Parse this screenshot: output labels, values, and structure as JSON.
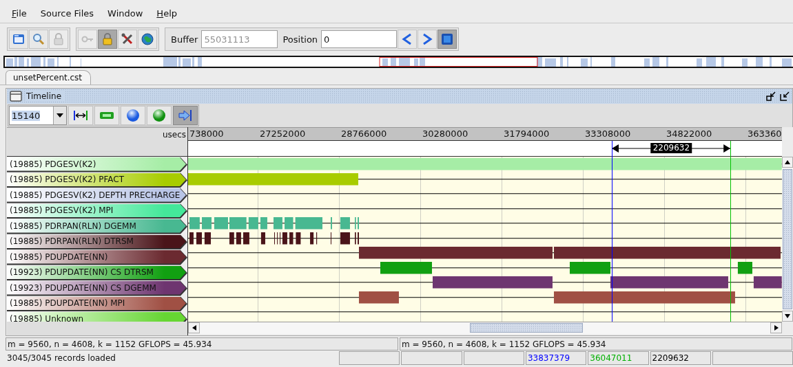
{
  "menu": [
    {
      "label": "File",
      "mnemonic": true
    },
    {
      "label": "Source Files",
      "mnemonic": false
    },
    {
      "label": "Window",
      "mnemonic": false
    },
    {
      "label": "Help",
      "mnemonic": true
    }
  ],
  "toolbar": {
    "groups": [
      [
        {
          "kind": "folder",
          "disabled": false,
          "pressed": false
        },
        {
          "kind": "magnifier",
          "disabled": false,
          "pressed": false
        },
        {
          "kind": "padlock",
          "disabled": true,
          "pressed": false
        }
      ],
      [
        {
          "kind": "key",
          "disabled": true,
          "pressed": false
        },
        {
          "kind": "padlock",
          "disabled": false,
          "pressed": true
        },
        {
          "kind": "tools",
          "disabled": false,
          "pressed": false
        },
        {
          "kind": "globe",
          "disabled": false,
          "pressed": false
        }
      ]
    ],
    "buffer": {
      "label": "Buffer",
      "value": "55031113",
      "disabled": true
    },
    "position": {
      "label": "Position",
      "value": "0"
    },
    "nav": [
      {
        "kind": "prev",
        "disabled": false,
        "pressed": false
      },
      {
        "kind": "next",
        "disabled": false,
        "pressed": false
      },
      {
        "kind": "fit",
        "disabled": false,
        "pressed": true
      }
    ]
  },
  "tabs": [
    {
      "label": "unsetPercent.cst",
      "selected": true
    }
  ],
  "panel": {
    "title": "Timeline"
  },
  "timeline_toolbar": {
    "zoom": "15140",
    "tools": [
      {
        "kind": "span",
        "pressed": false
      },
      {
        "kind": "bar",
        "pressed": false
      },
      {
        "kind": "blue-ball",
        "pressed": false
      },
      {
        "kind": "green-ball",
        "pressed": false
      },
      {
        "kind": "jump",
        "pressed": true
      }
    ]
  },
  "axis": {
    "unit": "usecs",
    "ticks": [
      "738000",
      "27252000",
      "28766000",
      "30280000",
      "31794000",
      "33308000",
      "34822000",
      "363360"
    ],
    "measurement": "2209632"
  },
  "cursors": [
    {
      "color": "#0000ff"
    },
    {
      "color": "#00c000"
    }
  ],
  "rows": [
    {
      "label": "(19885) PDGESV(K2)",
      "color": "#a6eda6"
    },
    {
      "label": "(19885) PDGESV(K2) PFACT",
      "color": "#a8cc00"
    },
    {
      "label": "(19885) PDGESV(K2) DEPTH PRECHARGE",
      "color": "#b8c4e6"
    },
    {
      "label": "(19885) PDGESV(K2) MPI",
      "color": "#44e89a"
    },
    {
      "label": "(19885) PDRPAN(RLN) DGEMM",
      "color": "#48b891"
    },
    {
      "label": "(19885) PDRPAN(RLN) DTRSM",
      "color": "#4a1419"
    },
    {
      "label": "(19885) PDUPDATE(NN)",
      "color": "#6b2a30"
    },
    {
      "label": "(19923) PDUPDATE(NN) CS DTRSM",
      "color": "#11a011"
    },
    {
      "label": "(19923) PDUPDATE(NN) CS DGEMM",
      "color": "#6e3570"
    },
    {
      "label": "(19885) PDUPDATE(NN) MPI",
      "color": "#a05044"
    },
    {
      "label": "(19885) Unknown",
      "color": "#66d633"
    }
  ],
  "status": {
    "left": "m = 9560, n = 4608, k = 1152  GFLOPS = 45.934",
    "right": "m = 9560, n = 4608, k = 1152  GFLOPS = 45.934",
    "message": "3045/3045 records loaded",
    "readouts": [
      {
        "text": "33837379",
        "color": "#0000ff"
      },
      {
        "text": "36047011",
        "color": "#00b000"
      },
      {
        "text": "2209632",
        "color": "#000000"
      }
    ]
  }
}
